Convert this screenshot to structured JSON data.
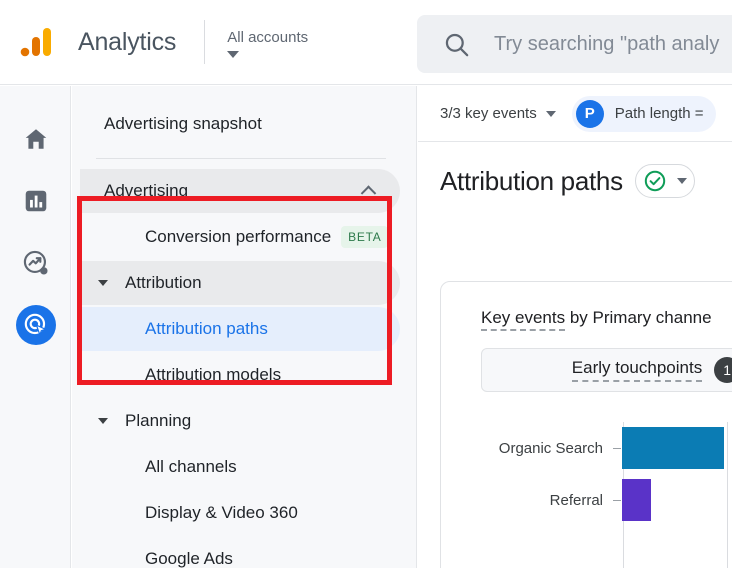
{
  "header": {
    "brand": "Analytics",
    "logo_icon": "google-analytics-logo",
    "account_selector": "All accounts",
    "account_caret_icon": "caret-down-icon",
    "divider": "header-divider"
  },
  "search": {
    "icon": "search-icon",
    "placeholder": "Try searching \"path analy"
  },
  "rail": {
    "items": [
      {
        "icon": "home-icon",
        "name": "home",
        "active": false
      },
      {
        "icon": "bar-chart-icon",
        "name": "reports",
        "active": false
      },
      {
        "icon": "explore-trend-icon",
        "name": "explore",
        "active": false
      },
      {
        "icon": "advertising-target-icon",
        "name": "advertising",
        "active": true
      }
    ],
    "active_color": "#1a73e8"
  },
  "nav": {
    "snapshot": "Advertising snapshot",
    "group_advertising": {
      "label": "Advertising",
      "chevron_icon": "chevron-up-icon",
      "expanded": true
    },
    "items": [
      {
        "label": "Conversion performance",
        "badge": "BETA",
        "level": "child"
      },
      {
        "label": "Attribution",
        "level": "sub-group",
        "caret_icon": "caret-down-icon",
        "hovered": true
      },
      {
        "label": "Attribution paths",
        "level": "child",
        "selected": true
      },
      {
        "label": "Attribution models",
        "level": "child",
        "selected": false
      }
    ],
    "group_planning": {
      "label": "Planning",
      "caret_icon": "caret-down-icon"
    },
    "planning_items": [
      {
        "label": "All channels"
      },
      {
        "label": "Display & Video 360"
      },
      {
        "label": "Google Ads"
      }
    ],
    "beta_badge_bg": "#e6f4ea",
    "selected_bg": "#e5eefc",
    "selected_text": "#1a73e8"
  },
  "annotation": {
    "type": "highlight-rectangle",
    "color": "#ed1c24"
  },
  "main": {
    "toolbar": {
      "key_events": "3/3 key events",
      "key_events_caret": "caret-down-icon",
      "path_chip_avatar": "P",
      "path_chip_label": "Path length ="
    },
    "page_title": "Attribution paths",
    "title_check_icon": "check-circle-icon",
    "title_caret_icon": "caret-down-icon",
    "card": {
      "title_link": "Key events",
      "title_rest": " by Primary channe",
      "tab_label": "Early touchpoints",
      "tab_badge": "1"
    }
  },
  "chart_data": {
    "type": "bar",
    "orientation": "horizontal",
    "title": "Key events by Primary channe",
    "categories": [
      "Organic Search",
      "Referral"
    ],
    "values": [
      100,
      28
    ],
    "colors": [
      "#0b7cb4",
      "#5a33c8"
    ],
    "xlabel": "",
    "ylabel": "",
    "grid": true,
    "legend": "none"
  }
}
